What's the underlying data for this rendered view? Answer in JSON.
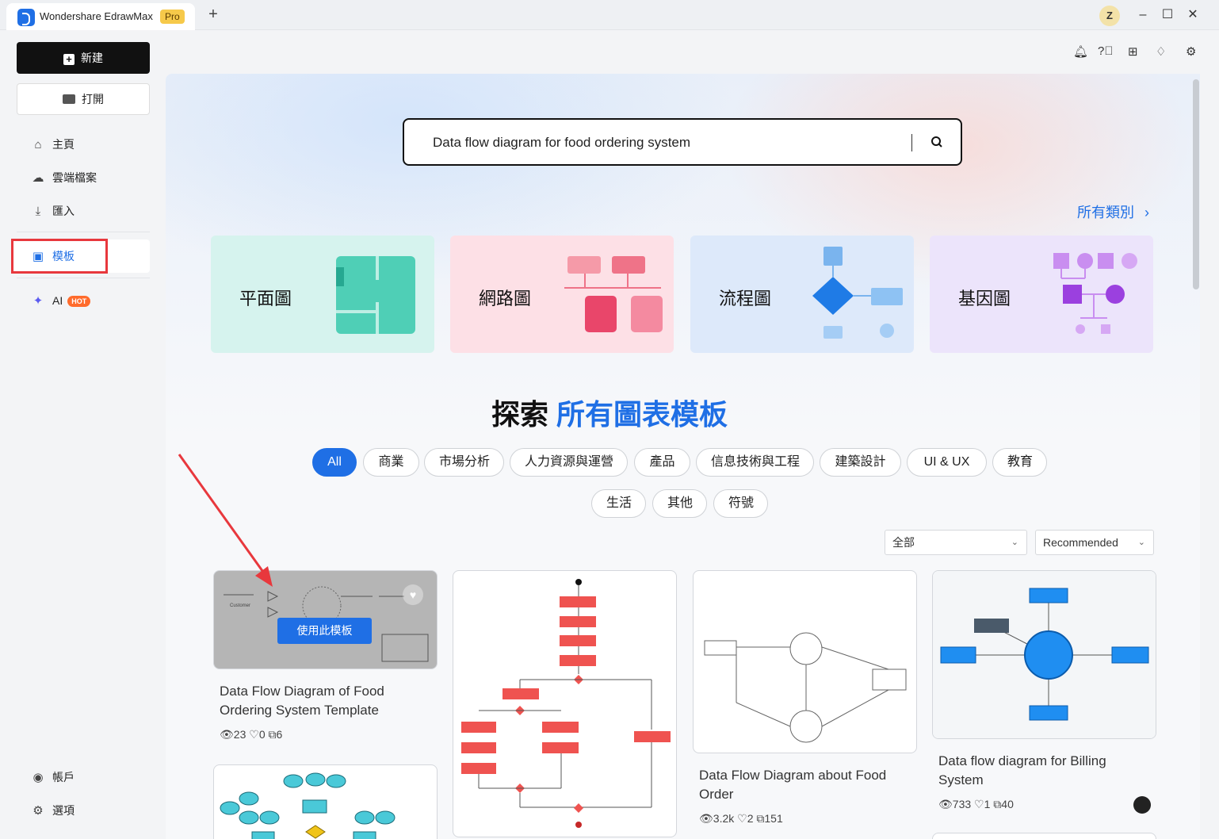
{
  "app": {
    "title": "Wondershare EdrawMax",
    "badge": "Pro",
    "new_tab": "+",
    "user_initial": "Z"
  },
  "window_controls": {
    "minimize": "–",
    "maximize": "☐",
    "close": "✕"
  },
  "sidebar": {
    "new_label": "新建",
    "open_label": "打開",
    "nav": [
      {
        "label": "主頁",
        "icon": "home-icon"
      },
      {
        "label": "雲端檔案",
        "icon": "cloud-icon"
      },
      {
        "label": "匯入",
        "icon": "import-icon"
      },
      {
        "label": "模板",
        "icon": "template-icon",
        "active": true
      },
      {
        "label": "AI",
        "icon": "ai-sparkle-icon",
        "badge": "HOT"
      }
    ],
    "bottom": [
      {
        "label": "帳戶",
        "icon": "account-icon"
      },
      {
        "label": "選項",
        "icon": "settings-icon"
      }
    ]
  },
  "topbar_icons": [
    "bell-icon",
    "help-icon",
    "apps-icon",
    "shirt-icon",
    "gear-icon"
  ],
  "search": {
    "value": "Data flow diagram for food ordering system"
  },
  "all_categories": "所有類別",
  "category_cards": [
    {
      "label": "平面圖",
      "color": "#d6f3ee"
    },
    {
      "label": "網路圖",
      "color": "#fde0e6"
    },
    {
      "label": "流程圖",
      "color": "#dde9fa"
    },
    {
      "label": "基因圖",
      "color": "#ece4fb"
    }
  ],
  "explore": {
    "prefix": "探索",
    "highlight": "所有圖表模板"
  },
  "filter_chips_row1": [
    "All",
    "商業",
    "市場分析",
    "人力資源與運營",
    "產品",
    "信息技術與工程",
    "建築設計",
    "UI & UX",
    "教育"
  ],
  "filter_chips_row2": [
    "生活",
    "其他",
    "符號"
  ],
  "filters": {
    "scope": "全部",
    "sort": "Recommended"
  },
  "templates": [
    {
      "title": "Data Flow Diagram of Food Ordering System Template",
      "views": "23",
      "likes": "0",
      "copies": "6",
      "hover_button": "使用此模板"
    },
    {
      "title": "",
      "views": "",
      "likes": "",
      "copies": ""
    },
    {
      "title": "Data Flow Diagram about Food Order",
      "views": "3.2k",
      "likes": "2",
      "copies": "151"
    },
    {
      "title": "Data flow diagram for Billing System",
      "views": "733",
      "likes": "1",
      "copies": "40"
    }
  ],
  "accent_color": "#1f6fe5",
  "highlight_color": "#e8383d"
}
